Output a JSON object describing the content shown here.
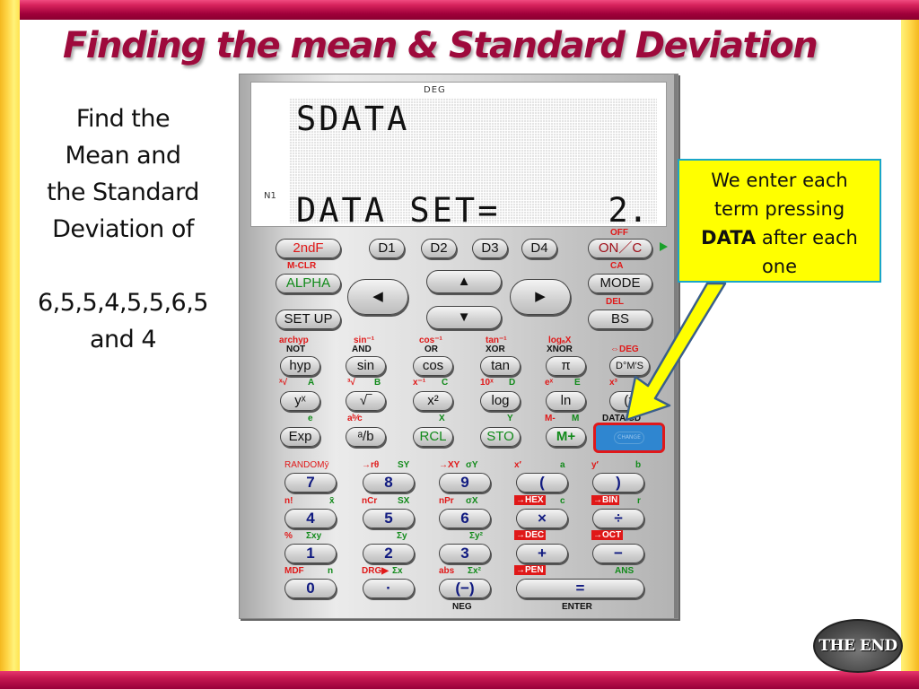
{
  "slide": {
    "title": "Finding  the mean & Standard Deviation",
    "problem": {
      "lines": [
        "Find the",
        "Mean and",
        "the Standard",
        "Deviation of"
      ],
      "data_line": "6,5,5,4,5,5,6,5",
      "data_line2": "and 4"
    },
    "callout": {
      "line1": "We enter each",
      "line2": "term pressing",
      "bold": "DATA",
      "line3_rest": " after each",
      "line4": "one"
    },
    "end_button": "THE END"
  },
  "calculator": {
    "display": {
      "indicator_top": "DEG",
      "indicator_left": "N1",
      "line1": "SDATA",
      "line2": "DATA SET=",
      "value": "2."
    },
    "keys": {
      "second_f": "2ndF",
      "d1": "D1",
      "d2": "D2",
      "d3": "D3",
      "d4": "D4",
      "on_c": "ON／C",
      "alpha": "ALPHA",
      "mode": "MODE",
      "setup": "SET UP",
      "bs": "BS",
      "left": "◀",
      "up": "▲",
      "right": "▶",
      "down": "▼",
      "hyp": "hyp",
      "sin": "sin",
      "cos": "cos",
      "tan": "tan",
      "pi": "π",
      "dms": "D°M′S",
      "yx": "yˣ",
      "sqrt": "√‾",
      "x2": "x²",
      "log": "log",
      "ln": "ln",
      "paren_x": "(x",
      "exp": "Exp",
      "ab": "ᵃ/b",
      "rcl": "RCL",
      "sto": "STO",
      "mplus": "M+",
      "data": "CHANGE",
      "n7": "7",
      "n8": "8",
      "n9": "9",
      "lparen": "(",
      "rparen": ")",
      "n4": "4",
      "n5": "5",
      "n6": "6",
      "mul": "×",
      "div": "÷",
      "n1": "1",
      "n2": "2",
      "n3": "3",
      "plus": "+",
      "minus": "−",
      "n0": "0",
      "dot": "·",
      "neg": "(−)",
      "equals": "="
    },
    "labels": {
      "off": "OFF",
      "mclr": "M-CLR",
      "ca": "CA",
      "del": "DEL",
      "archyp": "archyp",
      "not": "NOT",
      "asin": "sin⁻¹",
      "and": "AND",
      "acos": "cos⁻¹",
      "or": "OR",
      "atan": "tan⁻¹",
      "xor": "XOR",
      "logax": "logₐX",
      "xnor": "XNOR",
      "todeg": "⇔DEG",
      "xroot": "ˣ√",
      "a": "A",
      "cbrt": "³√",
      "b": "B",
      "xinv": "x⁻¹",
      "c": "C",
      "tenx": "10ˣ",
      "d": "D",
      "ex": "eˣ",
      "e_var": "E",
      "x3": "x³",
      "e_const": "e",
      "abc": "aᵇ⁄c",
      "x_var": "X",
      "y_var": "Y",
      "mminus": "M-",
      "m_var": "M",
      "data_cd": "DATA CD",
      "random": "RANDOMȳ",
      "tor": "→rθ",
      "sy": "SY",
      "toxy": "→XY",
      "sigy": "σY",
      "xp": "x′",
      "a_low": "a",
      "yp": "y′",
      "b_low": "b",
      "fact": "n!",
      "xbar": "x̄",
      "ncr": "nCr",
      "sx": "SX",
      "npr": "nPr",
      "sigx": "σX",
      "tohex": "→HEX",
      "c_low": "c",
      "tobin": "→BIN",
      "r_low": "r",
      "pct": "%",
      "sxy": "Σxy",
      "sumy": "Σy",
      "sumy2": "Σy²",
      "todec": "→DEC",
      "tooct": "→OCT",
      "mdf": "MDF",
      "n_low": "n",
      "drg": "DRG▶",
      "sumx": "Σx",
      "abs": "abs",
      "sumx2": "Σx²",
      "topen": "→PEN",
      "ans": "ANS",
      "neg": "NEG",
      "enter": "ENTER"
    }
  }
}
